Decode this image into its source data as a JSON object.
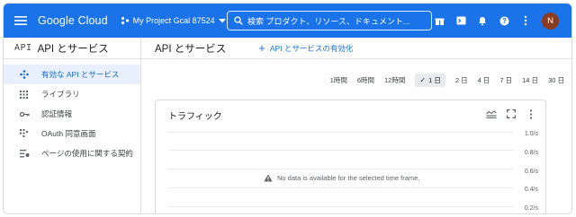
{
  "topbar": {
    "logo": "Google Cloud",
    "project": "My Project Gcal 87524",
    "search_placeholder": "検索  プロダクト、リソース、ドキュメント...",
    "avatar_initial": "N"
  },
  "sidebar": {
    "badge": "API",
    "title": "API とサービス",
    "items": [
      {
        "label": "有効な API とサービス",
        "icon": "diamond-nodes-icon",
        "active": true
      },
      {
        "label": "ライブラリ",
        "icon": "library-grid-icon"
      },
      {
        "label": "認証情報",
        "icon": "key-icon"
      },
      {
        "label": "OAuth 同意画面",
        "icon": "consent-icon"
      },
      {
        "label": "ページの使用に関する契約",
        "icon": "settings-list-icon"
      }
    ]
  },
  "main": {
    "title": "API とサービス",
    "enable_label": "API とサービスの有効化"
  },
  "time_ranges": [
    "1時間",
    "6時間",
    "12時間",
    "1 日",
    "2 日",
    "4 日",
    "7 日",
    "14 日",
    "30 日"
  ],
  "selected_range": "1 日",
  "card": {
    "title": "トラフィック",
    "no_data": "No data is available for the selected time frame.",
    "y_ticks": [
      "1.0/s",
      "0.8/s",
      "0.6/s",
      "0.4/s",
      "0.2/s"
    ]
  },
  "colors": {
    "brand": "#1a73e8",
    "active_bg": "#e8f0fe",
    "avatar": "#8d3b1f"
  }
}
